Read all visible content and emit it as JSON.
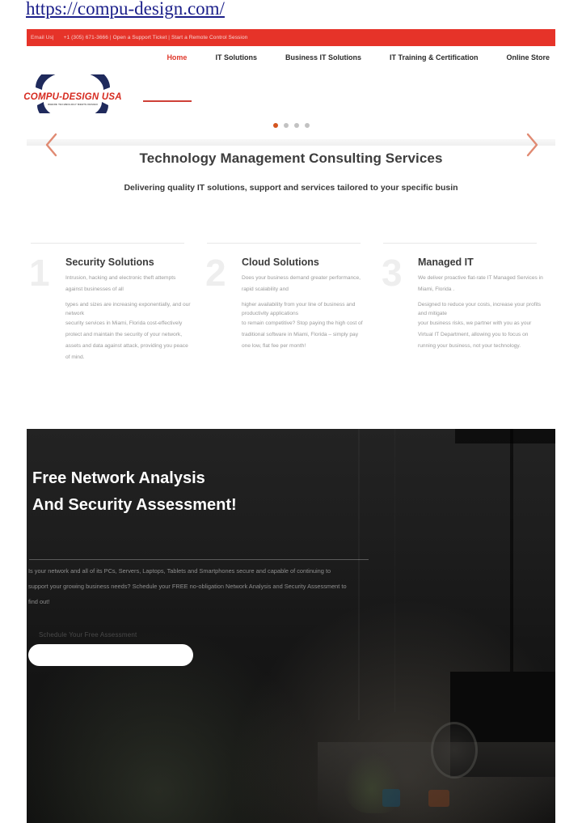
{
  "url_caption": "https://compu-design.com/",
  "topbar": {
    "email_label": "Email Us|",
    "phone": "+1 (305) 671-3666",
    "sep1": " | ",
    "support_ticket": "Open a Support Ticket",
    "sep2": " | ",
    "remote_session": "Start a Remote Control Session"
  },
  "nav": {
    "items": [
      {
        "label": "Home",
        "active": true
      },
      {
        "label": "IT Solutions",
        "active": false
      },
      {
        "label": "Business IT Solutions",
        "active": false
      },
      {
        "label": "IT Training & Certification",
        "active": false
      },
      {
        "label": "Online Store",
        "active": false
      }
    ]
  },
  "logo": {
    "wordmark": "COMPU-DESIGN USA",
    "tagline": "WHERE TECHNOLOGY MEETS DESIGN"
  },
  "hero": {
    "title": "Technology Management Consulting Services",
    "subtitle": "Delivering quality IT solutions, support and services tailored to your specific busin",
    "dots": [
      {
        "active": true
      },
      {
        "active": false
      },
      {
        "active": false
      },
      {
        "active": false
      }
    ],
    "prev_icon": "chevron-left-icon",
    "next_icon": "chevron-right-icon"
  },
  "features": [
    {
      "number": "1",
      "title": "Security Solutions",
      "lead": "Intrusion, hacking and electronic theft attempts against businesses of all",
      "body_a": "types and sizes are increasing exponentially, and our network",
      "body_b": "security services in Miami, Florida cost-effectively protect and maintain the security of your network, assets and data against attack, providing you peace of mind."
    },
    {
      "number": "2",
      "title": "Cloud Solutions",
      "lead": "Does your business demand greater performance, rapid scalability and",
      "body_a": "higher availability from your line of business and productivity applications",
      "body_b": "to remain competitive? Stop paying the high cost of traditional software in Miami, Florida – simply pay one low, flat fee per month!"
    },
    {
      "number": "3",
      "title": "Managed IT",
      "lead": "We deliver proactive flat-rate IT Managed Services in Miami, Florida .",
      "body_a": "Designed to reduce your costs, increase your profits and mitigate",
      "body_b": "your business risks, we partner with you as your Virtual IT Department, allowing you to focus on running your business, not your technology."
    }
  ],
  "cta": {
    "heading": "Free Network Analysis\nAnd Security Assessment!",
    "body": "Is your network and all of its PCs, Servers, Laptops, Tablets and Smartphones secure and capable of continuing to support your growing business needs? Schedule your FREE no-obligation Network Analysis and Security Assessment to find out!",
    "button_label": "Schedule Your Free Assessment",
    "button_text": ""
  },
  "colors": {
    "brand_red": "#e63329",
    "nav_active_red": "#e0392c",
    "accent_orange": "#d4541f",
    "arrow_salmon": "#e08a72",
    "logo_navy": "#1f2a5c",
    "dark_bg": "#151515"
  }
}
